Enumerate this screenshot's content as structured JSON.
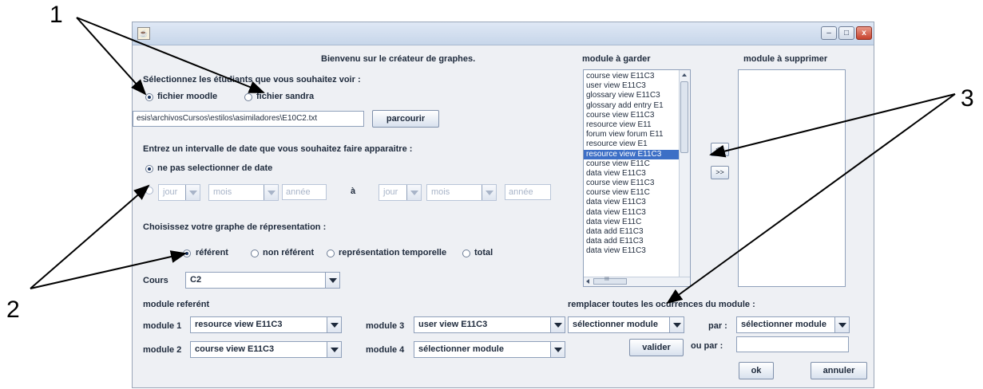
{
  "callouts": {
    "one": "1",
    "two": "2",
    "three": "3"
  },
  "window": {
    "minimize": "–",
    "maximize": "□",
    "close": "x"
  },
  "labels": {
    "welcome": "Bienvenu sur le créateur de graphes.",
    "select_students": "Sélectionnez les étudiants que vous souhaitez voir :",
    "date_interval": "Entrez un intervalle de date que vous souhaitez faire apparaitre :",
    "graph_choice": "Choisissez votre graphe de répresentation :",
    "cours": "Cours",
    "module_referent": "module referént",
    "module1": "module 1",
    "module2": "module 2",
    "module3": "module 3",
    "module4": "module 4",
    "module_keep": "module à garder",
    "module_delete": "module à supprimer",
    "replace_all": "remplacer toutes les ocurrences du module :",
    "par": "par :",
    "ou_par": "ou par :",
    "a": "à"
  },
  "radios": {
    "fichier_moodle": "fichier moodle",
    "fichier_sandra": "fichier sandra",
    "no_date": "ne pas selectionner de date",
    "referent": "référent",
    "non_referent": "non référent",
    "temporelle": "représentation temporelle",
    "total": "total"
  },
  "file_path": "esis\\archivosCursos\\estilos\\asimiladores\\E10C2.txt",
  "date_fields": {
    "jour": "jour",
    "mois": "mois",
    "annee": "année",
    "jour2": "jour",
    "mois2": "mois",
    "annee2": "année"
  },
  "combos": {
    "cours": "C2",
    "module1": "resource view     E11C3",
    "module2": "course view  E11C3",
    "module3": "user view  E11C3",
    "module4": "sélectionner module",
    "replace": "sélectionner module",
    "par": "sélectionner module"
  },
  "buttons": {
    "parcourir": "parcourir",
    "move_left": "<<",
    "move_right": ">>",
    "valider": "valider",
    "ok": "ok",
    "annuler": "annuler"
  },
  "module_list": [
    "course view  E11C3",
    "user view  E11C3",
    "glossary view  E11C3",
    "glossary add entry  E1",
    "course view  E11C3",
    "resource view      E11",
    "forum view forum  E11",
    "resource view       E1",
    "resource view  E11C3",
    "course view        E11C",
    "data view  E11C3",
    "course view  E11C3",
    "course view        E11C",
    "data view  E11C3",
    "data view    E11C3",
    "data view            E11C",
    "data add    E11C3",
    "data add  E11C3",
    "data view          E11C3"
  ],
  "selected_module_index": 8,
  "hscroll_grip": "III",
  "ou_par_value": ""
}
